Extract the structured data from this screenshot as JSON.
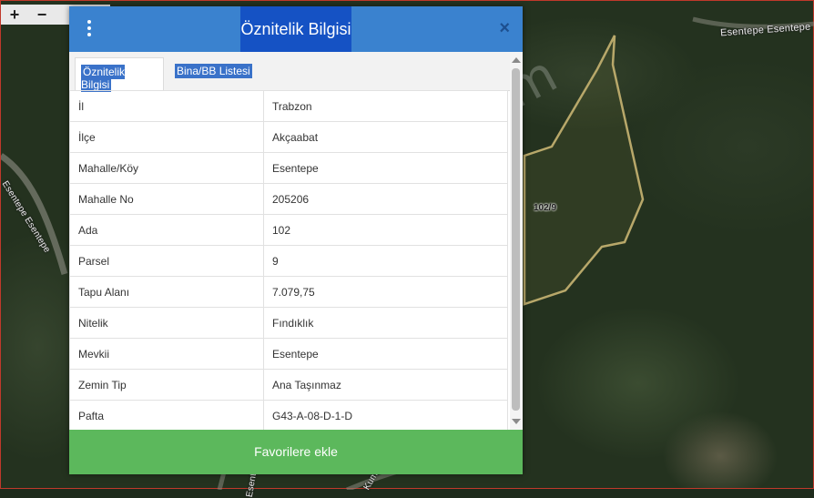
{
  "map": {
    "zoom_in": "+",
    "zoom_out": "−",
    "street_top": "Esentepe Esentepe",
    "street_left": "Esentepe Esentepe",
    "street_bottom": "Esentepe",
    "street_bottom2": "Kum",
    "parcel_label": "102/9",
    "watermark": "emlakjet.com"
  },
  "dialog": {
    "title": "Öznitelik Bilgisi",
    "close": "×",
    "tabs": [
      {
        "label": "Öznitelik Bilgisi"
      },
      {
        "label": "Bina/BB Listesi"
      }
    ],
    "rows": [
      {
        "key": "İl",
        "value": "Trabzon"
      },
      {
        "key": "İlçe",
        "value": "Akçaabat"
      },
      {
        "key": "Mahalle/Köy",
        "value": "Esentepe"
      },
      {
        "key": "Mahalle No",
        "value": "205206"
      },
      {
        "key": "Ada",
        "value": "102"
      },
      {
        "key": "Parsel",
        "value": "9"
      },
      {
        "key": "Tapu Alanı",
        "value": "7.079,75"
      },
      {
        "key": "Nitelik",
        "value": "Fındıklık"
      },
      {
        "key": "Mevkii",
        "value": "Esentepe"
      },
      {
        "key": "Zemin Tip",
        "value": "Ana Taşınmaz"
      },
      {
        "key": "Pafta",
        "value": "G43-A-08-D-1-D"
      }
    ],
    "favorite_button": "Favorilere ekle"
  },
  "colors": {
    "header": "#3a82cf",
    "title_highlight": "#1552c4",
    "button": "#5cb85c",
    "parcel_outline": "#b8a86a"
  }
}
